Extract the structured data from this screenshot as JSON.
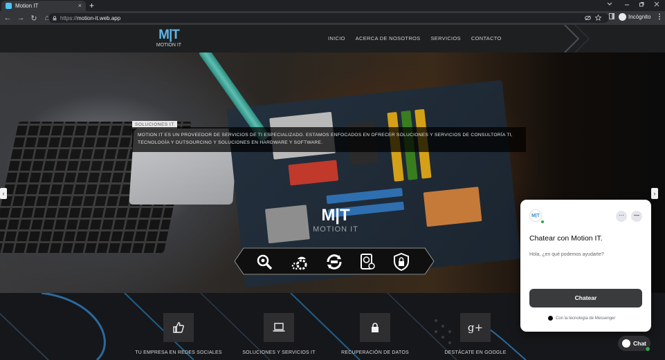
{
  "browser": {
    "tab_title": "Motion IT",
    "tab_close": "×",
    "new_tab": "+",
    "url_scheme": "https://",
    "url_host": "motion-it.web.app",
    "profile_label": "Incógnito",
    "nav_back": "←",
    "nav_forward": "→",
    "nav_reload": "↻",
    "nav_home": "⌂"
  },
  "site": {
    "logo_mark": "M|T",
    "logo_text": "MOTION IT",
    "menu": [
      "INICIO",
      "ACERCA DE NOSOTROS",
      "SERVICIOS",
      "CONTACTO"
    ],
    "hero_tag": "SOLUCIONES IT",
    "hero_text": "MOTION IT ES UN PROVEEDOR DE SERVICIOS DE TI ESPECIALIZADO. ESTAMOS ENFOCADOS EN OFRECER SOLUCIONES Y SERVICIOS DE CONSULTORÍA TI, TECNOLOGÍA Y OUTSOURCING Y SOLUCIONES EN HARDWARE Y SOFTWARE.",
    "center_logo_text": "MOTION IT",
    "strip_icons": [
      "search-gear-icon",
      "gears-icon",
      "update-icon",
      "hard-drive-icon",
      "shield-lock-icon"
    ],
    "hero_arrow_left": "‹",
    "hero_arrow_right": "›",
    "features": [
      {
        "icon": "thumbs-up-icon",
        "label": "TU EMPRESA EN REDES SOCIALES"
      },
      {
        "icon": "laptop-icon",
        "label": "SOLUCIONES Y SERVICIOS IT"
      },
      {
        "icon": "lock-icon",
        "label": "RECUPERACIÓN DE DATOS"
      },
      {
        "icon": "google-plus-icon",
        "label": "DESTÁCATE EN GOOGLE",
        "glyph": "g+"
      }
    ]
  },
  "chat": {
    "title": "Chatear con Motion IT.",
    "greeting": "Hola, ¿en qué podemos ayudarte?",
    "button": "Chatear",
    "footer": "Con la tecnología de Messenger",
    "more": "···",
    "minimize": "—",
    "fab_label": "Chat"
  }
}
